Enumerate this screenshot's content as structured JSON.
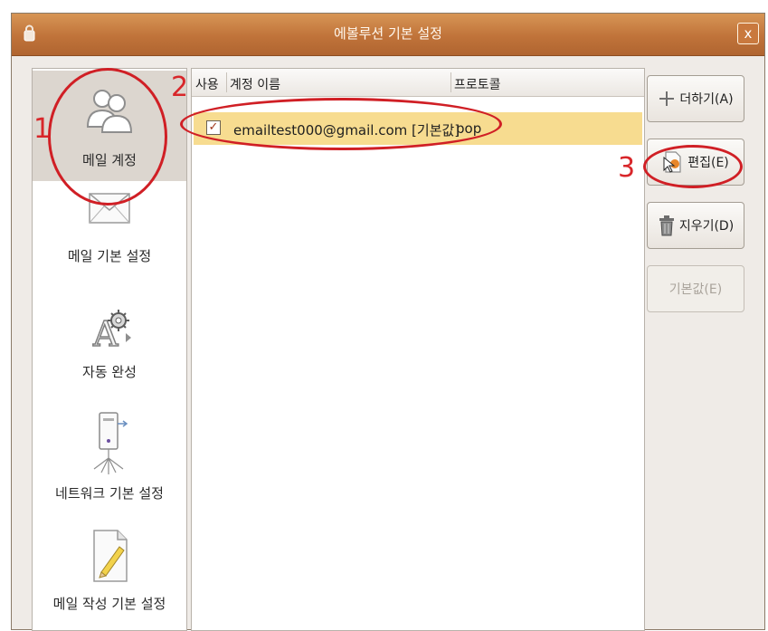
{
  "window": {
    "title": "에볼루션 기본 설정",
    "close_label": "x"
  },
  "sidebar": {
    "items": [
      {
        "label": "메일 계정",
        "icon": "accounts-icon",
        "selected": true
      },
      {
        "label": "메일 기본 설정",
        "icon": "envelope-icon"
      },
      {
        "label": "자동 완성",
        "icon": "autocomplete-icon"
      },
      {
        "label": "네트워크 기본 설정",
        "icon": "network-icon"
      },
      {
        "label": "메일 작성 기본 설정",
        "icon": "compose-icon"
      }
    ]
  },
  "accounts": {
    "columns": [
      "사용",
      "계정 이름",
      "프로토콜"
    ],
    "rows": [
      {
        "enabled": true,
        "check": "✓",
        "name": "emailtest000@gmail.com [기본값]",
        "protocol": "pop"
      }
    ]
  },
  "buttons": {
    "add": "더하기(A)",
    "edit": "편집(E)",
    "delete": "지우기(D)",
    "default": "기본값(E)"
  },
  "annotations": [
    "1",
    "2",
    "3"
  ],
  "colors": {
    "titlebar": "#c0733a",
    "selected_row": "#f7dc90",
    "annotation": "#d01f25"
  }
}
